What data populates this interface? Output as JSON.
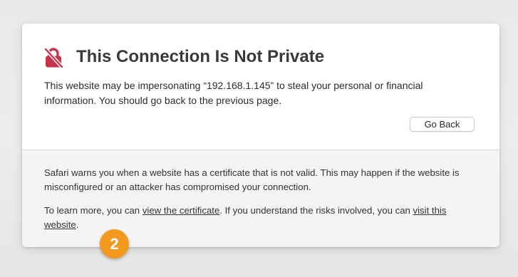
{
  "warning": {
    "title": "This Connection Is Not Private",
    "description": "This website may be impersonating “192.168.1.145” to steal your personal or financial information. You should go back to the previous page.",
    "go_back_label": "Go Back",
    "icon": "lock-broken-icon",
    "accent_color": "#c8334c"
  },
  "details": {
    "paragraph1": "Safari warns you when a website has a certificate that is not valid. This may happen if the website is misconfigured or an attacker has compromised your connection.",
    "paragraph2_prefix": "To learn more, you can ",
    "view_certificate_link": "view the certificate",
    "paragraph2_middle": ". If you understand the risks involved, you can ",
    "visit_website_link": "visit this website",
    "paragraph2_suffix": "."
  },
  "step_badge": {
    "number": "2",
    "color": "#f39a1e"
  }
}
